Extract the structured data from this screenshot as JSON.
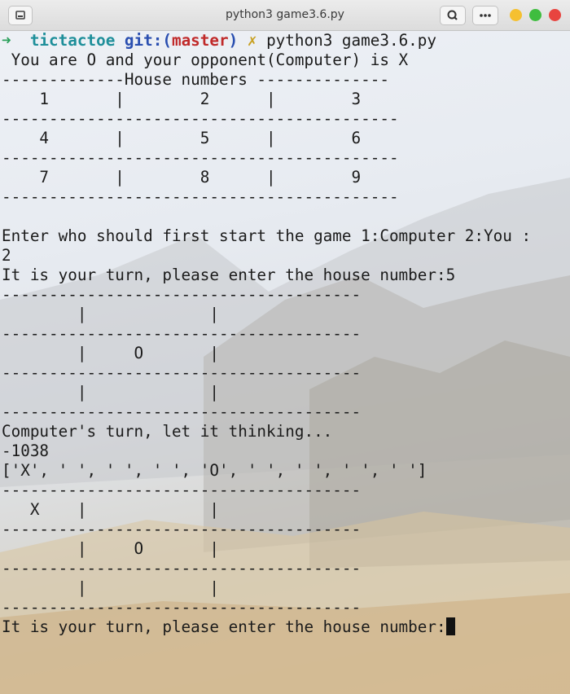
{
  "window": {
    "title": "python3 game3.6.py"
  },
  "prompt": {
    "arrow": "➜",
    "directory": "tictactoe",
    "git_label": "git:(",
    "branch": "master",
    "git_close": ")",
    "dirty_mark": "✗",
    "command": "python3 game3.6.py"
  },
  "output_lines": [
    " You are O and your opponent(Computer) is X",
    "-------------House numbers --------------",
    "    1       |        2      |        3",
    "------------------------------------------",
    "    4       |        5      |        6",
    "------------------------------------------",
    "    7       |        8      |        9",
    "------------------------------------------",
    "",
    "Enter who should first start the game 1:Computer 2:You :",
    "2",
    "It is your turn, please enter the house number:5",
    "--------------------------------------",
    "        |             |",
    "--------------------------------------",
    "        |     O       |",
    "--------------------------------------",
    "        |             |",
    "--------------------------------------",
    "Computer's turn, let it thinking...",
    "-1038",
    "['X', ' ', ' ', ' ', 'O', ' ', ' ', ' ', ' ']",
    "--------------------------------------",
    "   X    |             |",
    "--------------------------------------",
    "        |     O       |",
    "--------------------------------------",
    "        |             |",
    "--------------------------------------"
  ],
  "final_prompt": "It is your turn, please enter the house number:"
}
